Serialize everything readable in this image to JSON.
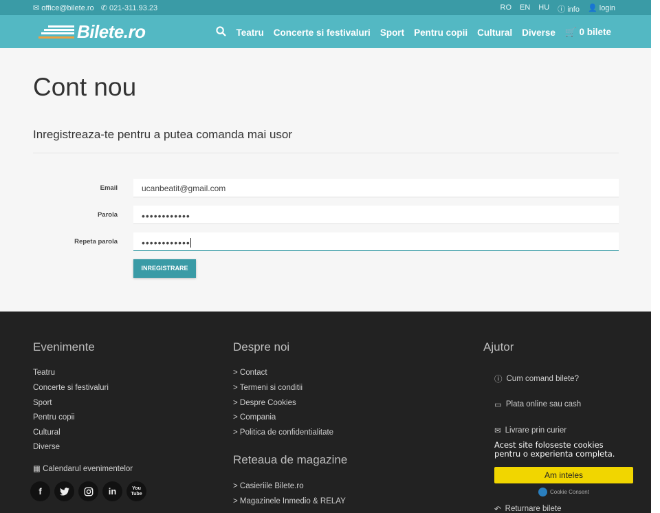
{
  "topbar": {
    "email": "office@bilete.ro",
    "phone": "021-311.93.23",
    "lang": [
      "RO",
      "EN",
      "HU"
    ],
    "info": "info",
    "login": "login"
  },
  "navbar": {
    "logo": "Bilete.ro",
    "items": [
      "Teatru",
      "Concerte si festivaluri",
      "Sport",
      "Pentru copii",
      "Cultural",
      "Diverse"
    ],
    "cart": "0 bilete"
  },
  "main": {
    "title": "Cont nou",
    "subtitle": "Inregistreaza-te pentru a putea comanda mai usor",
    "email_label": "Email",
    "email_value": "ucanbeatit@gmail.com",
    "password_label": "Parola",
    "password_value": "••••••••••••",
    "repeat_label": "Repeta parola",
    "repeat_value": "••••••••••••",
    "submit": "INREGISTRARE"
  },
  "footer": {
    "events_title": "Evenimente",
    "events": [
      "Teatru",
      "Concerte si festivaluri",
      "Sport",
      "Pentru copii",
      "Cultural",
      "Diverse"
    ],
    "calendar": "Calendarul evenimentelor",
    "about_title": "Despre noi",
    "about": [
      "> Contact",
      "> Termeni si conditii",
      "> Despre Cookies",
      "> Compania",
      "> Politica de confidentialitate"
    ],
    "network_title": "Reteaua de magazine",
    "network": [
      "> Casieriile Bilete.ro",
      "> Magazinele Inmedio & RELAY"
    ],
    "help_title": "Ajutor",
    "help": [
      "Cum comand bilete?",
      "Plata online sau cash",
      "Livrare prin curier",
      "Returnare bilete"
    ],
    "social": [
      "f",
      "t",
      "ig",
      "in",
      "You Tube"
    ]
  },
  "cookie": {
    "message": "Acest site foloseste cookies pentru o experienta completa.",
    "button": "Am inteles",
    "brand": "Cookie Consent"
  },
  "colors": {
    "topbar": "#3a9ba6",
    "navbar": "#53b8c3",
    "button": "#3a9ba6",
    "footer": "#222222",
    "cookie_button": "#f1d600"
  }
}
